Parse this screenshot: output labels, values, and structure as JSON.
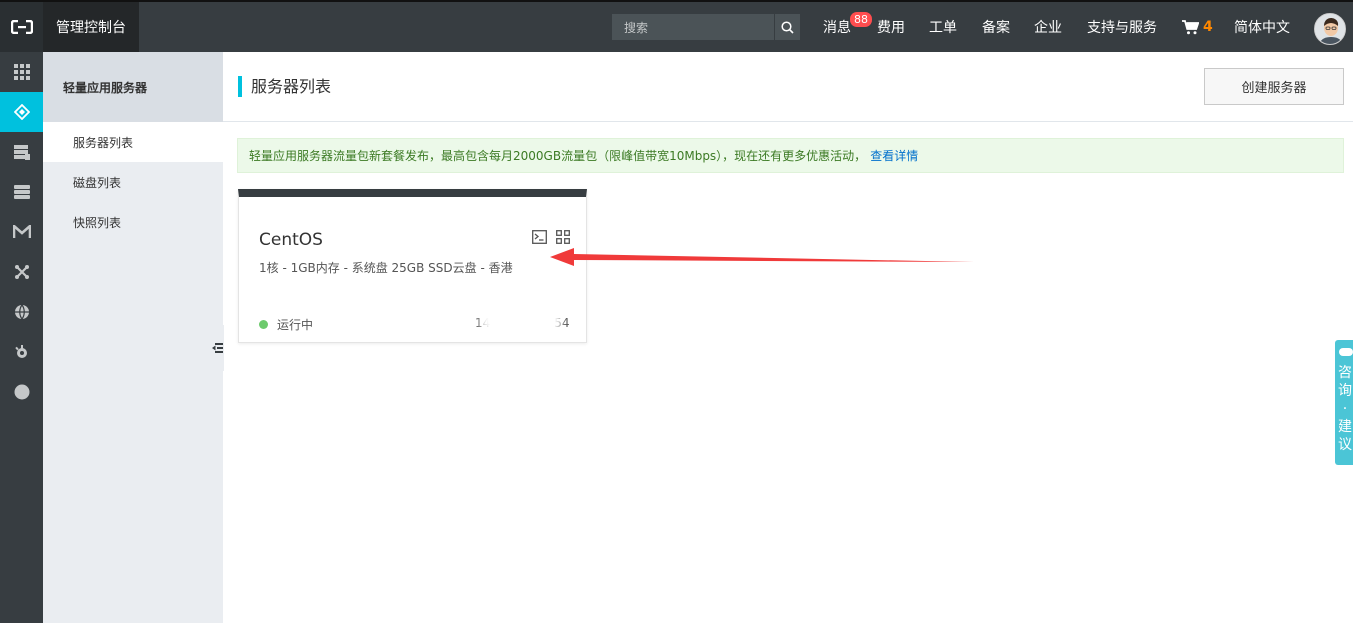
{
  "topbar": {
    "logo": "aliyun-logo",
    "console_label": "管理控制台",
    "search": {
      "placeholder": "搜索"
    },
    "nav": {
      "messages": "消息",
      "messages_badge": "88",
      "billing": "费用",
      "tickets": "工单",
      "icp": "备案",
      "enterprise": "企业",
      "support": "支持与服务",
      "cart_count": "4",
      "language": "简体中文"
    }
  },
  "rail": {
    "icons": [
      "grid-icon",
      "lighthouse-icon",
      "database-icon",
      "server-stack-icon",
      "m-icon",
      "cross-arrows-icon",
      "globe-icon",
      "gear-icon",
      "circle-icon"
    ],
    "active_index": 1
  },
  "sidebar": {
    "title": "轻量应用服务器",
    "items": [
      {
        "label": "服务器列表",
        "active": true
      },
      {
        "label": "磁盘列表",
        "active": false
      },
      {
        "label": "快照列表",
        "active": false
      }
    ]
  },
  "main": {
    "title": "服务器列表",
    "create_button": "创建服务器",
    "notice": {
      "text": "轻量应用服务器流量包新套餐发布，最高包含每月2000GB流量包（限峰值带宽10Mbps），现在还有更多优惠活动，",
      "link": "查看详情"
    },
    "servers": [
      {
        "name": "CentOS",
        "specs": "1核 - 1GB内存 - 系统盘 25GB SSD云盘 - 香港",
        "status": "运行中",
        "ip_start": "14",
        "ip_end": "54"
      }
    ]
  },
  "feedback": {
    "chars": [
      "咨",
      "询",
      "·",
      "建",
      "议"
    ]
  },
  "colors": {
    "topbar": "#373d41",
    "accent": "#00c1de",
    "running": "#6dca6d",
    "arrow": "#f03a3a",
    "badge": "#ff4d4f"
  }
}
